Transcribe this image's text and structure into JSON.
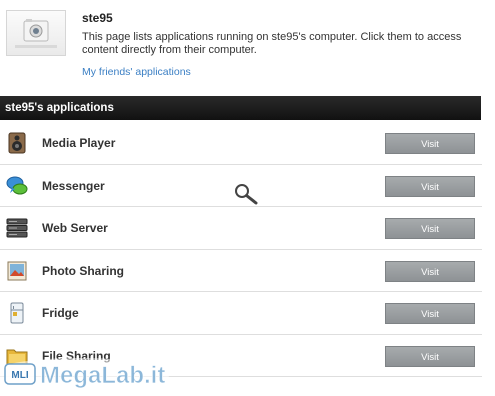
{
  "profile": {
    "username": "ste95",
    "description": "This page lists applications running on ste95's computer. Click them to access content directly from their computer.",
    "friends_link": "My friends' applications"
  },
  "section_title": "ste95's applications",
  "apps": [
    {
      "name": "Media Player",
      "icon": "speaker-icon",
      "button": "Visit"
    },
    {
      "name": "Messenger",
      "icon": "chat-bubbles-icon",
      "button": "Visit"
    },
    {
      "name": "Web Server",
      "icon": "server-icon",
      "button": "Visit"
    },
    {
      "name": "Photo Sharing",
      "icon": "photo-icon",
      "button": "Visit"
    },
    {
      "name": "Fridge",
      "icon": "fridge-icon",
      "button": "Visit"
    },
    {
      "name": "File Sharing",
      "icon": "folder-icon",
      "button": "Visit"
    }
  ],
  "watermark": {
    "text": "MegaLab.it",
    "badge": "MLI"
  },
  "colors": {
    "accent_link": "#3b7fc4",
    "section_bar": "#1a1a1a",
    "button": "#9a9ea1"
  }
}
